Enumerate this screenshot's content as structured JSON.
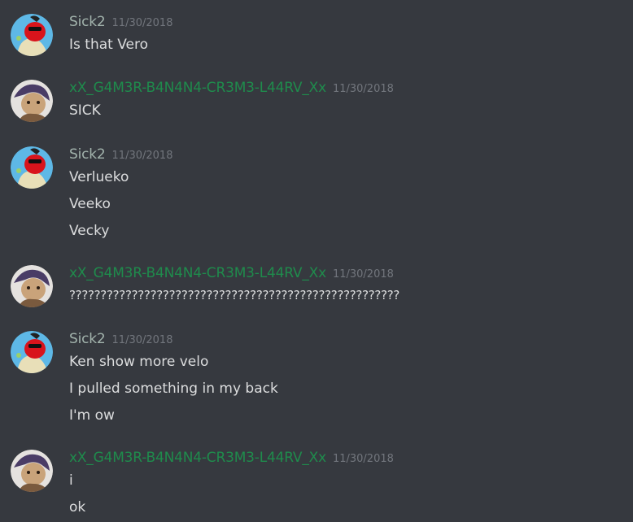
{
  "messages": [
    {
      "author": "Sick2",
      "author_color": "#a3b4ad",
      "avatar": "cartoon-dog-avatar",
      "timestamp": "11/30/2018",
      "lines": [
        "Is that Vero"
      ]
    },
    {
      "author": "xX_G4M3R-B4N4N4-CR3M3-L44RV_Xx",
      "author_color": "#1f8b4c",
      "avatar": "anime-character-avatar",
      "timestamp": "11/30/2018",
      "lines": [
        "SICK"
      ]
    },
    {
      "author": "Sick2",
      "author_color": "#a3b4ad",
      "avatar": "cartoon-dog-avatar",
      "timestamp": "11/30/2018",
      "lines": [
        "Verlueko",
        "Veeko",
        "Vecky"
      ]
    },
    {
      "author": "xX_G4M3R-B4N4N4-CR3M3-L44RV_Xx",
      "author_color": "#1f8b4c",
      "avatar": "anime-character-avatar",
      "timestamp": "11/30/2018",
      "lines": [
        "?????????????????????????????????????????????????????"
      ]
    },
    {
      "author": "Sick2",
      "author_color": "#a3b4ad",
      "avatar": "cartoon-dog-avatar",
      "timestamp": "11/30/2018",
      "lines": [
        "Ken show more velo",
        "I pulled something in my back",
        "I'm ow"
      ]
    },
    {
      "author": "xX_G4M3R-B4N4N4-CR3M3-L44RV_Xx",
      "author_color": "#1f8b4c",
      "avatar": "anime-character-avatar",
      "timestamp": "11/30/2018",
      "lines": [
        "i",
        "ok"
      ]
    }
  ]
}
